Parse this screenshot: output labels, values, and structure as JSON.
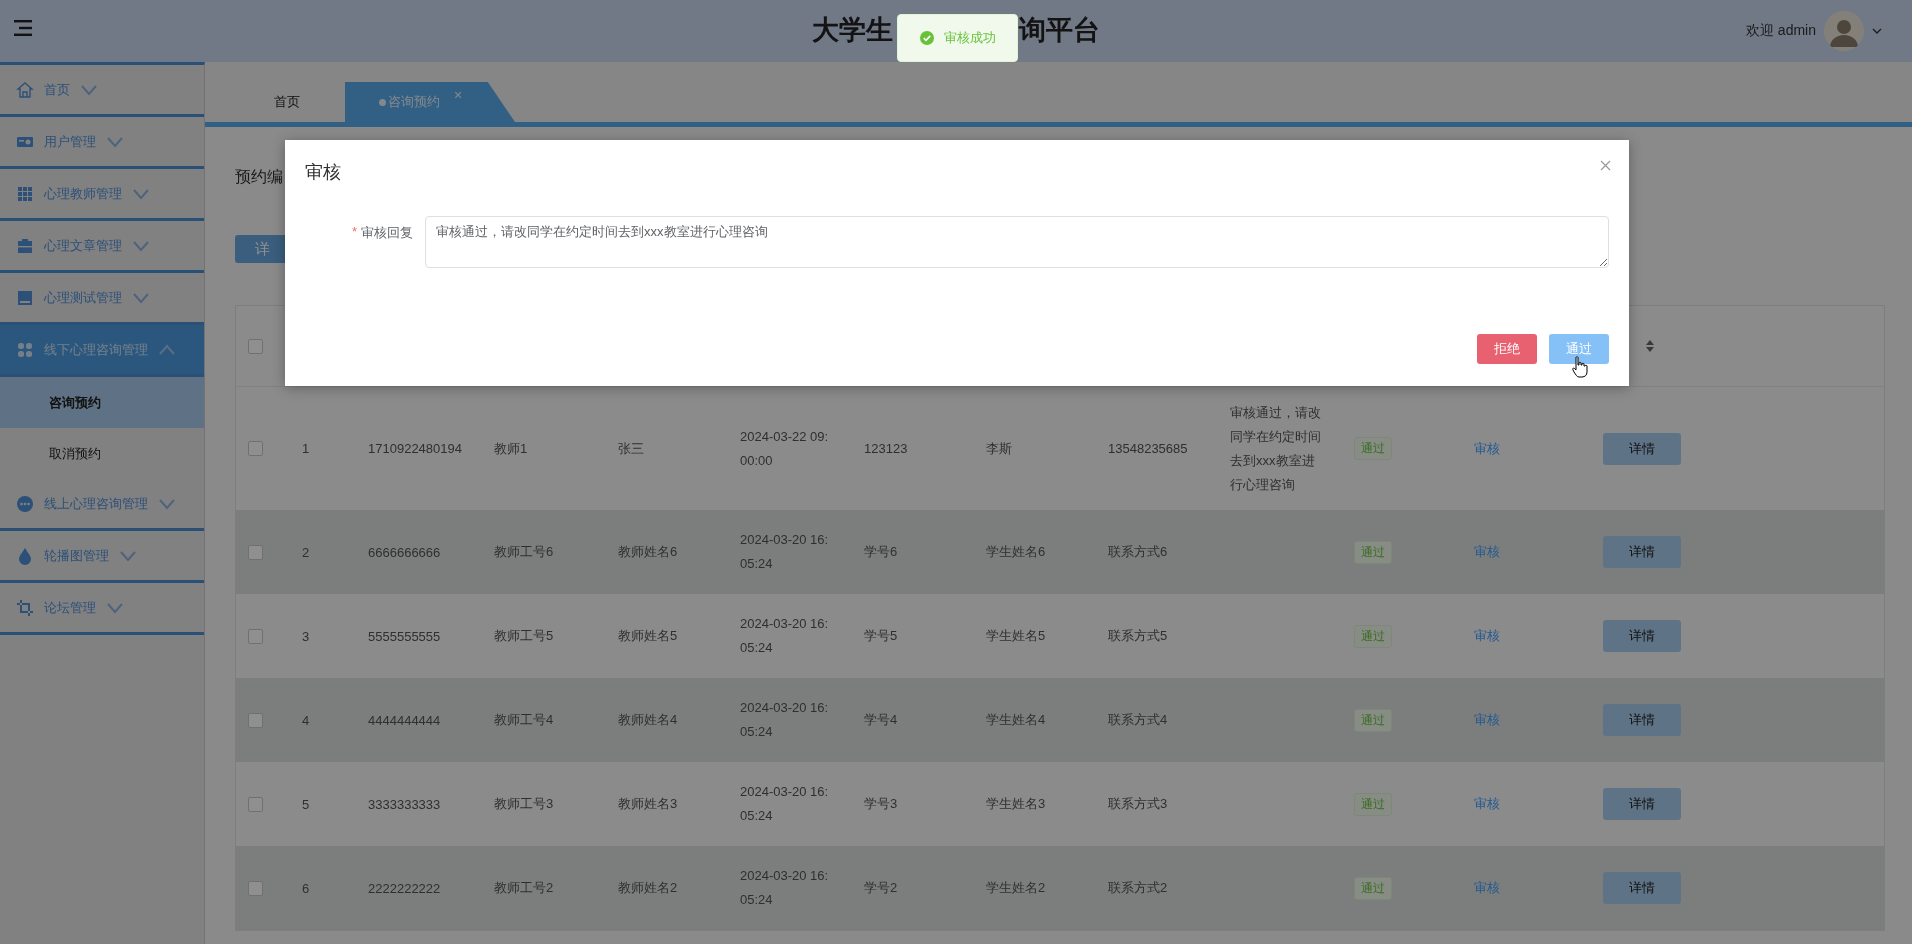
{
  "header": {
    "title_left": "大学生",
    "title_right": "询平台",
    "welcome": "欢迎 admin"
  },
  "toast": {
    "message": "审核成功"
  },
  "sidebar": {
    "items": [
      {
        "label": "首页",
        "selected": false,
        "expanded": false
      },
      {
        "label": "用户管理",
        "selected": false,
        "expanded": false
      },
      {
        "label": "心理教师管理",
        "selected": false,
        "expanded": false
      },
      {
        "label": "心理文章管理",
        "selected": false,
        "expanded": false
      },
      {
        "label": "心理测试管理",
        "selected": false,
        "expanded": false
      },
      {
        "label": "线下心理咨询管理",
        "selected": true,
        "expanded": true,
        "children": [
          {
            "label": "咨询预约",
            "selected": true
          },
          {
            "label": "取消预约",
            "selected": false
          }
        ]
      },
      {
        "label": "线上心理咨询管理",
        "selected": false,
        "expanded": false
      },
      {
        "label": "轮播图管理",
        "selected": false,
        "expanded": false
      },
      {
        "label": "论坛管理",
        "selected": false,
        "expanded": false
      }
    ]
  },
  "tabs": [
    {
      "label": "首页",
      "selected": false
    },
    {
      "label": "咨询预约",
      "selected": true,
      "close_label": "×"
    }
  ],
  "search": {
    "label": "预约编"
  },
  "toolbar": {
    "button": "详"
  },
  "table": {
    "header_checked": false,
    "rows": [
      {
        "checked": false,
        "index": "1",
        "code": "1710922480194",
        "teacher_no": "教师1",
        "teacher_name": "张三",
        "time": "2024-03-22 09:00:00",
        "student_no": "123123",
        "student_name": "李斯",
        "phone": "13548235685",
        "reply": "审核通过，请改同学在约定时间去到xxx教室进行心理咨询",
        "status": "通过",
        "audit": "审核",
        "action": "详情"
      },
      {
        "checked": false,
        "index": "2",
        "code": "6666666666",
        "teacher_no": "教师工号6",
        "teacher_name": "教师姓名6",
        "time": "2024-03-20 16:05:24",
        "student_no": "学号6",
        "student_name": "学生姓名6",
        "phone": "联系方式6",
        "status": "通过",
        "audit": "审核",
        "action": "详情"
      },
      {
        "checked": false,
        "index": "3",
        "code": "5555555555",
        "teacher_no": "教师工号5",
        "teacher_name": "教师姓名5",
        "time": "2024-03-20 16:05:24",
        "student_no": "学号5",
        "student_name": "学生姓名5",
        "phone": "联系方式5",
        "status": "通过",
        "audit": "审核",
        "action": "详情"
      },
      {
        "checked": false,
        "index": "4",
        "code": "4444444444",
        "teacher_no": "教师工号4",
        "teacher_name": "教师姓名4",
        "time": "2024-03-20 16:05:24",
        "student_no": "学号4",
        "student_name": "学生姓名4",
        "phone": "联系方式4",
        "status": "通过",
        "audit": "审核",
        "action": "详情"
      },
      {
        "checked": false,
        "index": "5",
        "code": "3333333333",
        "teacher_no": "教师工号3",
        "teacher_name": "教师姓名3",
        "time": "2024-03-20 16:05:24",
        "student_no": "学号3",
        "student_name": "学生姓名3",
        "phone": "联系方式3",
        "status": "通过",
        "audit": "审核",
        "action": "详情"
      },
      {
        "checked": false,
        "index": "6",
        "code": "2222222222",
        "teacher_no": "教师工号2",
        "teacher_name": "教师姓名2",
        "time": "2024-03-20 16:05:24",
        "student_no": "学号2",
        "student_name": "学生姓名2",
        "phone": "联系方式2",
        "status": "通过",
        "audit": "审核",
        "action": "详情"
      }
    ]
  },
  "dialog": {
    "title": "审核",
    "field_label": "审核回复",
    "required_mark": "*",
    "value": "审核通过，请改同学在约定时间去到xxx教室进行心理咨询",
    "buttons": [
      {
        "label": "拒绝",
        "kind": "danger"
      },
      {
        "label": "通过",
        "kind": "primary"
      }
    ]
  }
}
